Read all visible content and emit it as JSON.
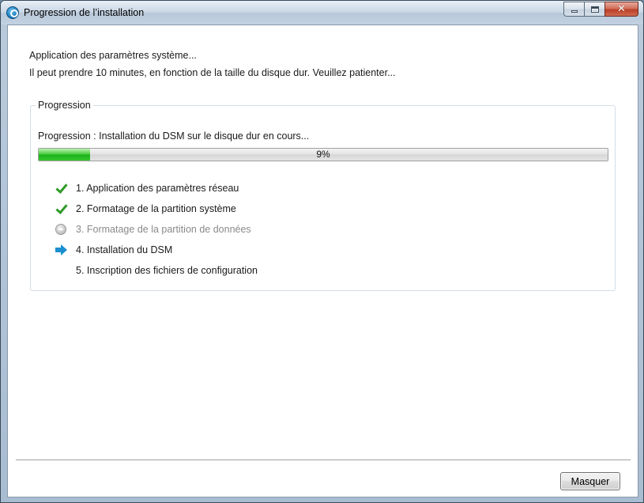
{
  "window": {
    "title": "Progression de l’installation",
    "icon": "app-logo-icon"
  },
  "message": {
    "line1": "Application des paramètres système...",
    "line2": "Il peut prendre 10 minutes, en fonction de la taille du disque dur. Veuillez patienter..."
  },
  "progress_group": {
    "legend": "Progression",
    "status": "Progression : Installation du DSM sur le disque dur en cours...",
    "percent_text": "9%",
    "percent_value": 9,
    "bar_color": "#1fb41a"
  },
  "steps": [
    {
      "label": "1. Application des paramètres réseau",
      "state": "done",
      "icon": "check-icon"
    },
    {
      "label": "2. Formatage de la partition système",
      "state": "done",
      "icon": "check-icon"
    },
    {
      "label": "3. Formatage de la partition de données",
      "state": "skipped",
      "icon": "skipped-icon"
    },
    {
      "label": "4. Installation du DSM",
      "state": "current",
      "icon": "arrow-right-icon"
    },
    {
      "label": "5. Inscription des fichiers de configuration",
      "state": "pending",
      "icon": ""
    }
  ],
  "footer": {
    "hide_label": "Masquer"
  }
}
